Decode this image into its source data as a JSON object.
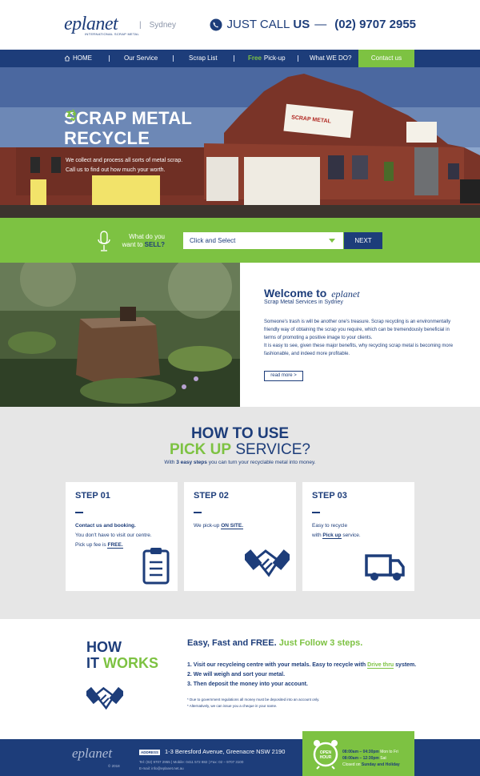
{
  "header": {
    "logo_text": "planet",
    "logo_tagline": "INTERNATIONAL SCRAP METAL",
    "city": "Sydney",
    "call_prefix": "JUST CALL",
    "call_bold": "US",
    "call_dash": "—",
    "phone": "(02) 9707 2955"
  },
  "nav": {
    "home": "HOME",
    "service": "Our Service",
    "scrap_list": "Scrap List",
    "free": "Free",
    "pickup": "Pick-up",
    "what": "What WE DO?",
    "contact": "Contact us"
  },
  "hero": {
    "title_line1": "SCRAP METAL",
    "title_line2": "RECYCLE",
    "sub_line1": "We collect and process all sorts of metal scrap.",
    "sub_line2": "Call us to find out how much your worth.",
    "sign_text": "SCRAP METAL"
  },
  "sellbar": {
    "q_line1": "What do you",
    "q_line2a": "want to",
    "q_line2b": "SELL?",
    "select_value": "Click and Select",
    "next": "NEXT"
  },
  "welcome": {
    "title": "Welcome to",
    "brand": "planet",
    "subtitle": "Scrap Metal Services in Sydney",
    "p1": "Someone's trash is will be another one's treasure. Scrap recycling is an environmentally friendly way of obtaining the scrap you require, which can be tremendously beneficial in terms of promoting a positive image to your clients.",
    "p2": "It is easy to see, given these major benefits, why recycling scrap metal is becoming more fashionable, and indeed more profitable.",
    "read_more": "read more >"
  },
  "howto": {
    "line1": "HOW TO USE",
    "line2_green": "PICK UP",
    "line2_rest": "SERVICE?",
    "sub_pre": "With",
    "sub_bold": "3 easy steps",
    "sub_post": "you can turn your recyclable metal into money.",
    "steps": [
      {
        "title": "STEP 01",
        "l1": "Contact us and booking.",
        "l2": "You don't have to visit our centre.",
        "l3_pre": "Pick up fee is",
        "l3_bold": "FREE."
      },
      {
        "title": "STEP 02",
        "l1_pre": "We pick-up",
        "l1_bold": "ON SITE."
      },
      {
        "title": "STEP 03",
        "l1": "Easy to recycle",
        "l2_pre": "with",
        "l2_bold": "Pick up",
        "l2_post": "service."
      }
    ]
  },
  "hiw": {
    "big1": "HOW",
    "big2a": "IT",
    "big2b": "WORKS",
    "title_pre": "Easy, Fast and FREE.",
    "title_green": "Just Follow 3 steps.",
    "item1_pre": "1. Visit our recycleing centre with your metals. Easy to recycle with",
    "item1_green": "Drive thru",
    "item1_post": "system.",
    "item2": "2. We will weigh and sort your metal.",
    "item3": "3. Then deposit the money into your account.",
    "note1": "* Due to government regulations all money must be deposited into an account only.",
    "note2": "* Alternatively, we can issue you a cheque in your name."
  },
  "footer": {
    "logo": "planet",
    "copyright": "© 2018",
    "address_tag": "ADDRESS",
    "address": "1-3 Beresford Avenue, Greenacre NSW 2190",
    "contact_line": "Tel: (02) 9707 2955  |  Mobile: 0411 572 882  |  Fax: 02 – 9707 3100",
    "email_line": "E-mail: info@eplanet.net.au",
    "open_label": "OPEN HOUR",
    "hours1": "08:00am – 04:30pm",
    "days1": "Mon to Fri",
    "hours2": "08:00am – 12:30pm",
    "days2": "Sat",
    "closed": "Closed on",
    "closed_days": "Sunday and Holiday"
  },
  "colors": {
    "navy": "#1d3d7a",
    "green": "#7dc242",
    "grey_bg": "#e6e6e6"
  }
}
